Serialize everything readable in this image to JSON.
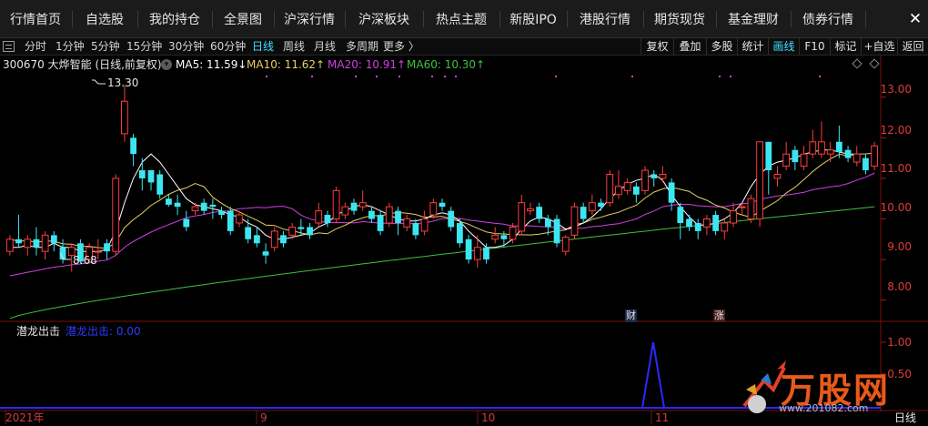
{
  "nav": {
    "tabs": [
      "行情首页",
      "自选股",
      "我的持仓",
      "全景图",
      "沪深行情",
      "沪深板块",
      "热点主题",
      "新股IPO",
      "港股行情",
      "期货现货",
      "基金理财",
      "债券行情"
    ],
    "close_label": "✕"
  },
  "toolbar": {
    "periods": [
      "分时",
      "1分钟",
      "5分钟",
      "15分钟",
      "30分钟",
      "60分钟",
      "日线",
      "周线",
      "月线",
      "多周期",
      "更多 〉"
    ],
    "active_period": "日线",
    "right_buttons": [
      "复权",
      "叠加",
      "多股",
      "统计",
      "画线",
      "F10",
      "标记",
      "+自选",
      "返回"
    ],
    "active_right": "画线"
  },
  "stock": {
    "code_name": "300670 大烨智能 (日线,前复权)",
    "ma5_label": "MA5: 11.59↓",
    "ma10_label": "MA10: 11.62↑",
    "ma20_label": "MA20: 10.91↑",
    "ma60_label": "MA60: 10.30↑"
  },
  "colors": {
    "up": "#ff3d3d",
    "down": "#3ce6f0",
    "ma5": "#ffffff",
    "ma10": "#e6d060",
    "ma20": "#d040e0",
    "ma60": "#40c040",
    "axis_text": "#e03c3c"
  },
  "price_axis": [
    "13.00",
    "12.00",
    "11.00",
    "10.00",
    "9.00",
    "8.00"
  ],
  "annotations": {
    "high": "13.30",
    "low": "8.68"
  },
  "event_markers": [
    "财",
    "涨"
  ],
  "sub_indicator": {
    "name": "潜龙出击",
    "value_label": "潜龙出击: 0.00",
    "axis": [
      "1.00",
      "0.50"
    ]
  },
  "x_axis": {
    "labels": [
      "2021年",
      "9",
      "10",
      "11"
    ],
    "period_tag": "日线"
  },
  "watermark": {
    "brand": "万股网",
    "url": "www.201082.com"
  },
  "chart_data": {
    "type": "candlestick",
    "ylim": [
      7.5,
      13.6
    ],
    "candles": [
      [
        9.2,
        9.5,
        9.6,
        9.1
      ],
      [
        9.5,
        9.4,
        10.1,
        9.3
      ],
      [
        9.3,
        9.5,
        9.6,
        9.1
      ],
      [
        9.5,
        9.3,
        9.8,
        9.1
      ],
      [
        9.2,
        9.6,
        9.7,
        9.0
      ],
      [
        9.6,
        9.4,
        9.7,
        9.2
      ],
      [
        9.3,
        9.0,
        9.5,
        8.9
      ],
      [
        9.1,
        9.3,
        9.4,
        8.7
      ],
      [
        9.4,
        8.95,
        9.5,
        8.9
      ],
      [
        9.0,
        9.3,
        9.4,
        8.9
      ],
      [
        9.2,
        9.2,
        9.5,
        9.0
      ],
      [
        9.4,
        9.2,
        9.5,
        9.0
      ],
      [
        9.2,
        11.0,
        11.1,
        9.1
      ],
      [
        12.1,
        12.9,
        13.3,
        11.9
      ],
      [
        12.0,
        11.6,
        12.1,
        11.3
      ],
      [
        11.2,
        11.0,
        11.5,
        10.7
      ],
      [
        11.2,
        10.9,
        11.1,
        10.7
      ],
      [
        11.1,
        10.6,
        11.2,
        10.5
      ],
      [
        10.5,
        10.35,
        10.6,
        10.3
      ],
      [
        10.4,
        10.3,
        10.6,
        10.1
      ],
      [
        10.0,
        9.8,
        10.2,
        9.7
      ],
      [
        10.2,
        10.3,
        10.4,
        10.1
      ],
      [
        10.4,
        10.2,
        10.5,
        10.1
      ],
      [
        10.35,
        10.3,
        10.5,
        10.0
      ],
      [
        10.2,
        10.1,
        10.3,
        10.0
      ],
      [
        10.2,
        9.7,
        10.3,
        9.6
      ],
      [
        9.9,
        10.1,
        10.2,
        9.8
      ],
      [
        9.8,
        9.5,
        10.0,
        9.4
      ],
      [
        9.6,
        9.4,
        9.8,
        9.3
      ],
      [
        9.2,
        9.1,
        9.4,
        8.9
      ],
      [
        9.3,
        9.7,
        9.8,
        9.2
      ],
      [
        9.6,
        9.4,
        9.7,
        9.3
      ],
      [
        9.6,
        9.8,
        9.9,
        9.5
      ],
      [
        9.8,
        9.75,
        10.0,
        9.6
      ],
      [
        9.8,
        9.6,
        9.9,
        9.5
      ],
      [
        9.9,
        10.2,
        10.4,
        9.8
      ],
      [
        10.1,
        9.9,
        10.2,
        9.8
      ],
      [
        10.0,
        10.7,
        10.8,
        9.9
      ],
      [
        10.1,
        10.3,
        10.4,
        10.0
      ],
      [
        10.4,
        10.2,
        10.5,
        10.1
      ],
      [
        10.3,
        10.4,
        10.7,
        10.2
      ],
      [
        10.2,
        10.0,
        10.3,
        9.9
      ],
      [
        10.1,
        9.7,
        10.2,
        9.6
      ],
      [
        9.9,
        10.3,
        10.4,
        9.8
      ],
      [
        10.2,
        9.9,
        10.3,
        9.6
      ],
      [
        9.8,
        10.0,
        10.1,
        9.7
      ],
      [
        9.9,
        9.6,
        10.0,
        9.5
      ],
      [
        9.7,
        10.0,
        10.2,
        9.6
      ],
      [
        10.1,
        10.4,
        10.5,
        10.0
      ],
      [
        10.4,
        10.3,
        10.5,
        10.2
      ],
      [
        10.2,
        9.8,
        10.3,
        9.7
      ],
      [
        9.9,
        9.4,
        10.0,
        9.3
      ],
      [
        9.5,
        9.0,
        9.6,
        8.9
      ],
      [
        9.0,
        9.3,
        9.6,
        8.8
      ],
      [
        9.3,
        9.0,
        9.4,
        8.9
      ],
      [
        9.5,
        9.6,
        9.8,
        9.4
      ],
      [
        9.6,
        9.5,
        9.7,
        9.3
      ],
      [
        9.5,
        9.8,
        9.9,
        9.4
      ],
      [
        9.7,
        10.4,
        10.6,
        9.6
      ],
      [
        10.2,
        10.25,
        10.4,
        10.1
      ],
      [
        10.3,
        10.0,
        10.4,
        9.9
      ],
      [
        10.0,
        9.8,
        10.1,
        9.6
      ],
      [
        10.0,
        9.4,
        10.1,
        9.3
      ],
      [
        9.2,
        9.55,
        9.6,
        9.1
      ],
      [
        9.6,
        10.3,
        10.4,
        9.5
      ],
      [
        10.3,
        10.0,
        10.4,
        9.9
      ],
      [
        10.2,
        10.4,
        10.6,
        10.1
      ],
      [
        10.4,
        10.3,
        10.5,
        10.2
      ],
      [
        10.4,
        11.1,
        11.2,
        10.3
      ],
      [
        10.6,
        10.8,
        11.2,
        10.5
      ],
      [
        10.7,
        10.9,
        11.0,
        10.6
      ],
      [
        10.8,
        10.6,
        10.9,
        10.4
      ],
      [
        10.7,
        11.2,
        11.3,
        10.6
      ],
      [
        11.1,
        11.0,
        11.2,
        10.8
      ],
      [
        11.0,
        11.1,
        11.3,
        10.9
      ],
      [
        10.9,
        10.4,
        11.0,
        10.2
      ],
      [
        10.3,
        9.9,
        10.4,
        9.5
      ],
      [
        10.0,
        9.8,
        10.1,
        9.7
      ],
      [
        9.9,
        9.7,
        10.0,
        9.5
      ],
      [
        9.8,
        10.0,
        10.1,
        9.6
      ],
      [
        10.1,
        9.7,
        10.2,
        9.6
      ],
      [
        9.7,
        9.9,
        10.0,
        9.5
      ],
      [
        9.9,
        10.2,
        10.4,
        9.8
      ],
      [
        10.3,
        10.3,
        10.4,
        10.1
      ],
      [
        10.0,
        10.5,
        10.6,
        9.9
      ],
      [
        10.0,
        11.9,
        11.9,
        9.8
      ],
      [
        11.9,
        11.2,
        11.9,
        10.6
      ],
      [
        11.0,
        11.1,
        11.3,
        10.8
      ],
      [
        11.3,
        11.6,
        11.9,
        11.2
      ],
      [
        11.7,
        11.4,
        11.8,
        11.2
      ],
      [
        11.3,
        11.6,
        11.8,
        11.2
      ],
      [
        11.6,
        11.9,
        12.2,
        11.5
      ],
      [
        11.6,
        11.9,
        12.4,
        11.5
      ],
      [
        11.6,
        11.7,
        11.9,
        11.4
      ],
      [
        11.9,
        11.65,
        12.3,
        11.5
      ],
      [
        11.7,
        11.5,
        11.8,
        11.4
      ],
      [
        11.4,
        11.6,
        11.8,
        11.3
      ],
      [
        11.5,
        11.2,
        11.6,
        11.1
      ],
      [
        11.3,
        11.8,
        11.9,
        11.2
      ]
    ],
    "ma5": [
      9.3,
      9.3,
      9.35,
      9.3,
      9.3,
      9.4,
      9.3,
      9.3,
      9.2,
      9.2,
      9.2,
      9.25,
      9.7,
      10.4,
      11.0,
      11.4,
      11.6,
      11.4,
      11.1,
      10.8,
      10.5,
      10.35,
      10.3,
      10.25,
      10.2,
      10.1,
      10.05,
      9.9,
      9.8,
      9.6,
      9.5,
      9.5,
      9.55,
      9.6,
      9.65,
      9.8,
      9.9,
      10.1,
      10.2,
      10.3,
      10.35,
      10.3,
      10.2,
      10.1,
      10.0,
      9.95,
      9.95,
      10.0,
      10.1,
      10.15,
      10.1,
      9.95,
      9.7,
      9.5,
      9.3,
      9.3,
      9.35,
      9.5,
      9.75,
      9.95,
      10.05,
      10.0,
      9.9,
      9.75,
      9.8,
      9.9,
      10.05,
      10.25,
      10.5,
      10.7,
      10.85,
      10.95,
      11.0,
      11.1,
      10.95,
      10.6,
      10.3,
      10.05,
      9.85,
      9.85,
      9.9,
      10.0,
      10.15,
      10.4,
      10.8,
      11.1,
      11.3,
      11.4,
      11.45,
      11.5,
      11.6,
      11.65,
      11.7,
      11.7,
      11.65,
      11.6,
      11.6
    ]
  }
}
